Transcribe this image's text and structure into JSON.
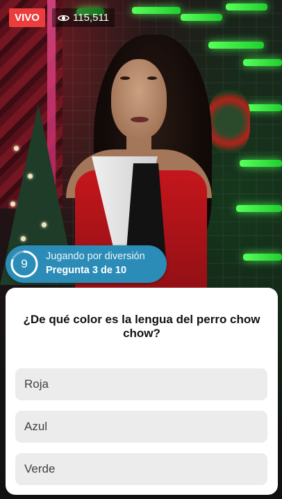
{
  "live": {
    "badge_label": "VIVO",
    "viewer_count": "115,511",
    "viewer_icon": "eye-icon"
  },
  "status": {
    "question_number": "9",
    "mode_label": "Jugando por diversión",
    "progress_label": "Pregunta 3 de 10",
    "timer_fraction": 0.8,
    "accent_color": "#2c8cb8"
  },
  "quiz": {
    "question": "¿De qué color es la lengua del perro chow chow?",
    "options": [
      {
        "label": "Roja"
      },
      {
        "label": "Azul"
      },
      {
        "label": "Verde"
      }
    ]
  }
}
